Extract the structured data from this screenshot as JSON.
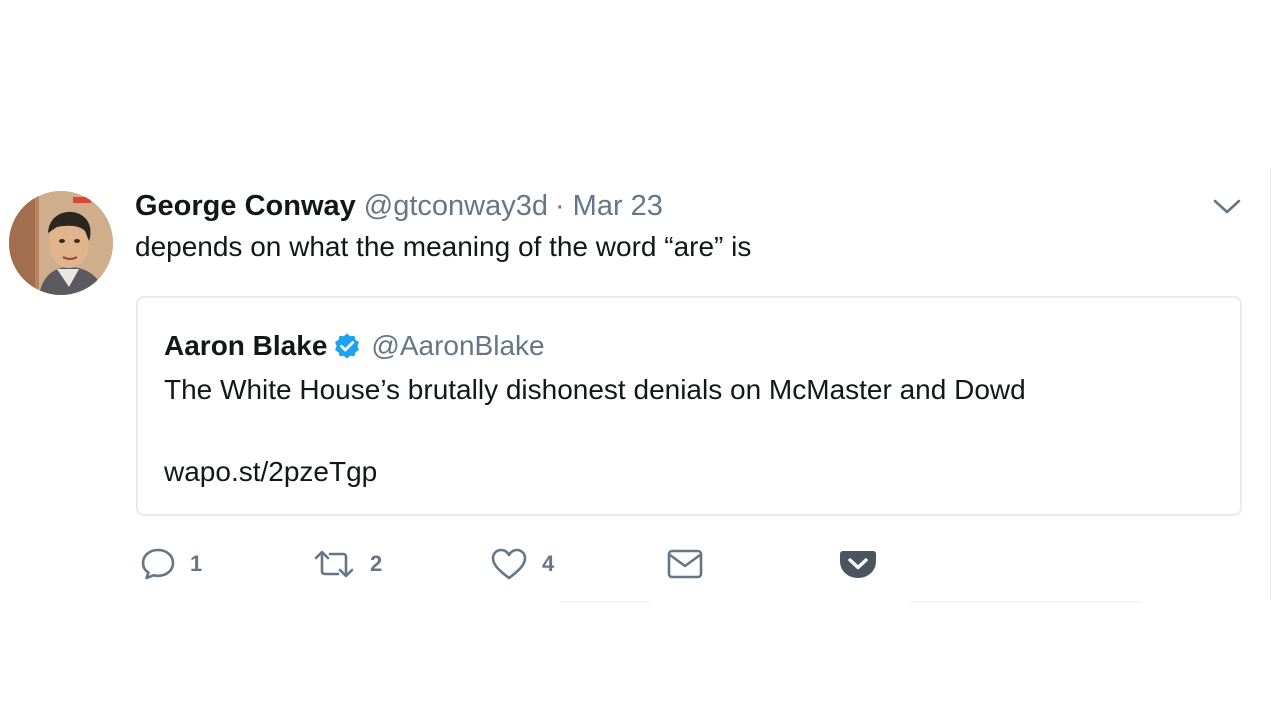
{
  "tweet": {
    "author": {
      "display_name": "George Conway",
      "handle": "@gtconway3d"
    },
    "separator": "·",
    "date": "Mar 23",
    "text": "depends on what the meaning of the word “are” is",
    "menu_icon": "chevron-down-icon"
  },
  "quoted_tweet": {
    "author": {
      "display_name": "Aaron Blake",
      "handle": "@AaronBlake",
      "verified": true
    },
    "text": "The White House’s brutally dishonest denials on McMaster and Dowd",
    "link": "wapo.st/2pzeTgp"
  },
  "actions": [
    {
      "icon": "reply-icon",
      "count": "1"
    },
    {
      "icon": "retweet-icon",
      "count": "2"
    },
    {
      "icon": "heart-icon",
      "count": "4"
    },
    {
      "icon": "envelope-icon",
      "count": ""
    },
    {
      "icon": "pocket-icon",
      "count": ""
    }
  ],
  "colors": {
    "text": "#14171a",
    "muted": "#657786",
    "verified": "#1da1f2",
    "border": "#e6ecf0"
  }
}
